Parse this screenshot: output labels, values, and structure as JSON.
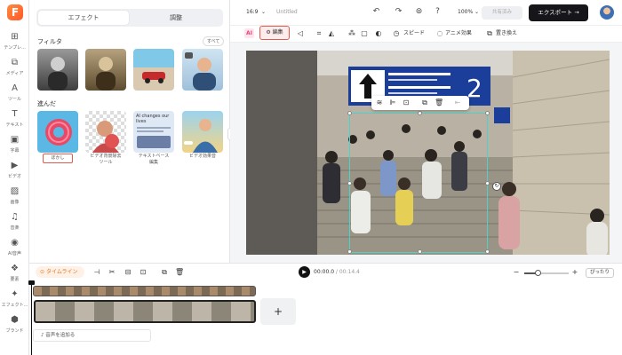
{
  "app": {
    "logo": "F",
    "project_title": "Untitled"
  },
  "rail": [
    {
      "icon": "template-icon",
      "label": "テンプレ..."
    },
    {
      "icon": "media-icon",
      "label": "メディア"
    },
    {
      "icon": "ai-tool-icon",
      "label": "ツール"
    },
    {
      "icon": "text-icon",
      "label": "テキスト"
    },
    {
      "icon": "subtitle-icon",
      "label": "字幕"
    },
    {
      "icon": "video-icon",
      "label": "ビデオ"
    },
    {
      "icon": "image-icon",
      "label": "画像"
    },
    {
      "icon": "music-icon",
      "label": "音楽"
    },
    {
      "icon": "ai-voice-icon",
      "label": "AI音声"
    },
    {
      "icon": "element-icon",
      "label": "要素"
    },
    {
      "icon": "effect-icon",
      "label": "エフェクト..."
    },
    {
      "icon": "brand-icon",
      "label": "ブランド"
    }
  ],
  "panel": {
    "tabs": [
      "エフェクト",
      "調整"
    ],
    "filter_title": "フィルタ",
    "see_all": "すべて",
    "advanced_title": "進んだ",
    "advanced_items": [
      {
        "label": "ぼかし",
        "selected": true
      },
      {
        "label": "ビデオ背景除去\nツール",
        "selected": false
      },
      {
        "label": "テキストベース\n編集",
        "selected": false
      },
      {
        "label": "ビデオ効果音",
        "selected": false
      }
    ],
    "thumb_card_text": "AI changes our lives"
  },
  "topbar": {
    "aspect": "16:9",
    "zoom": "100%",
    "share_label": "共有済み",
    "export_label": "エクスポート"
  },
  "toolbar": {
    "edit_label": "編集",
    "speed_label": "スピード",
    "anime_label": "アニメ効果",
    "replace_label": "置き換え"
  },
  "timeline": {
    "mode_label": "タイムライン",
    "current_time": "00:00.0",
    "separator": " / ",
    "total_time": "00:14.4",
    "fit_label": "ぴったり",
    "add_audio": "音声を追加る",
    "zoom_level": 0.3
  },
  "colors": {
    "accent": "#e25a4d",
    "selection": "#4ad3c8",
    "export_bg": "#16161a"
  }
}
